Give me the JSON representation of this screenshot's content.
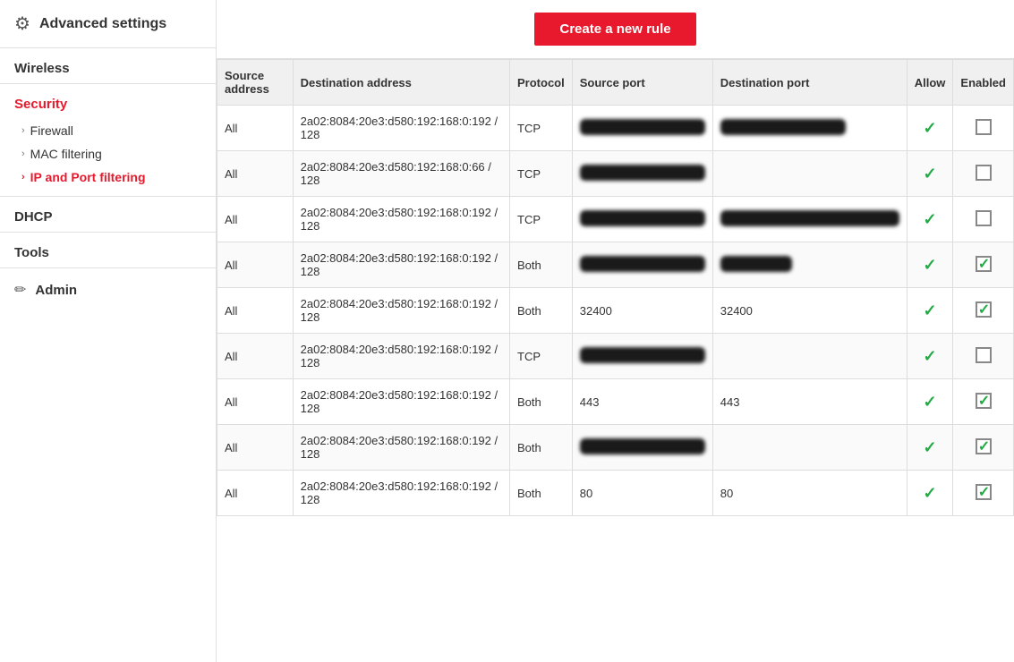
{
  "sidebar": {
    "header_title": "Advanced settings",
    "sections": [
      {
        "type": "plain",
        "label": "Wireless"
      },
      {
        "type": "expandable",
        "label": "Security",
        "active": true,
        "items": [
          {
            "label": "Firewall",
            "active": false
          },
          {
            "label": "MAC filtering",
            "active": false
          },
          {
            "label": "IP and Port filtering",
            "active": true
          }
        ]
      },
      {
        "type": "plain",
        "label": "DHCP"
      },
      {
        "type": "plain",
        "label": "Tools"
      }
    ],
    "admin_label": "Admin"
  },
  "main": {
    "create_button_label": "Create a new rule",
    "table": {
      "columns": [
        {
          "key": "source_address",
          "label": "Source address"
        },
        {
          "key": "destination_address",
          "label": "Destination address"
        },
        {
          "key": "protocol",
          "label": "Protocol"
        },
        {
          "key": "source_port",
          "label": "Source port"
        },
        {
          "key": "destination_port",
          "label": "Destination port"
        },
        {
          "key": "allow",
          "label": "Allow"
        },
        {
          "key": "enabled",
          "label": "Enabled"
        }
      ],
      "rows": [
        {
          "source_address": "All",
          "destination_address": "2a02:8084:20e3:d580:192:168:0:192 / 128",
          "protocol": "TCP",
          "source_port": "BLURRED",
          "destination_port": "BLURRED",
          "allow": true,
          "enabled": false
        },
        {
          "source_address": "All",
          "destination_address": "2a02:8084:20e3:d580:192:168:0:66 / 128",
          "protocol": "TCP",
          "source_port": "BLURRED",
          "destination_port": "",
          "allow": true,
          "enabled": false
        },
        {
          "source_address": "All",
          "destination_address": "2a02:8084:20e3:d580:192:168:0:192 / 128",
          "protocol": "TCP",
          "source_port": "BLURRED",
          "destination_port": "BLURRED_WIDE",
          "allow": true,
          "enabled": false
        },
        {
          "source_address": "All",
          "destination_address": "2a02:8084:20e3:d580:192:168:0:192 / 128",
          "protocol": "Both",
          "source_port": "BLURRED",
          "destination_port": "BLURRED_PARTIAL",
          "allow": true,
          "enabled": true
        },
        {
          "source_address": "All",
          "destination_address": "2a02:8084:20e3:d580:192:168:0:192 / 128",
          "protocol": "Both",
          "source_port": "32400",
          "destination_port": "32400",
          "allow": true,
          "enabled": true
        },
        {
          "source_address": "All",
          "destination_address": "2a02:8084:20e3:d580:192:168:0:192 / 128",
          "protocol": "TCP",
          "source_port": "BLURRED",
          "destination_port": "",
          "allow": true,
          "enabled": false
        },
        {
          "source_address": "All",
          "destination_address": "2a02:8084:20e3:d580:192:168:0:192 / 128",
          "protocol": "Both",
          "source_port": "443",
          "destination_port": "443",
          "allow": true,
          "enabled": true
        },
        {
          "source_address": "All",
          "destination_address": "2a02:8084:20e3:d580:192:168:0:192 / 128",
          "protocol": "Both",
          "source_port": "BLURRED",
          "destination_port": "",
          "allow": true,
          "enabled": true
        },
        {
          "source_address": "All",
          "destination_address": "2a02:8084:20e3:d580:192:168:0:192 / 128",
          "protocol": "Both",
          "source_port": "80",
          "destination_port": "80",
          "allow": true,
          "enabled": true
        }
      ]
    }
  },
  "icons": {
    "gear": "⚙",
    "pencil": "✏",
    "arrow_right": "›",
    "arrow_right_active": "›"
  }
}
